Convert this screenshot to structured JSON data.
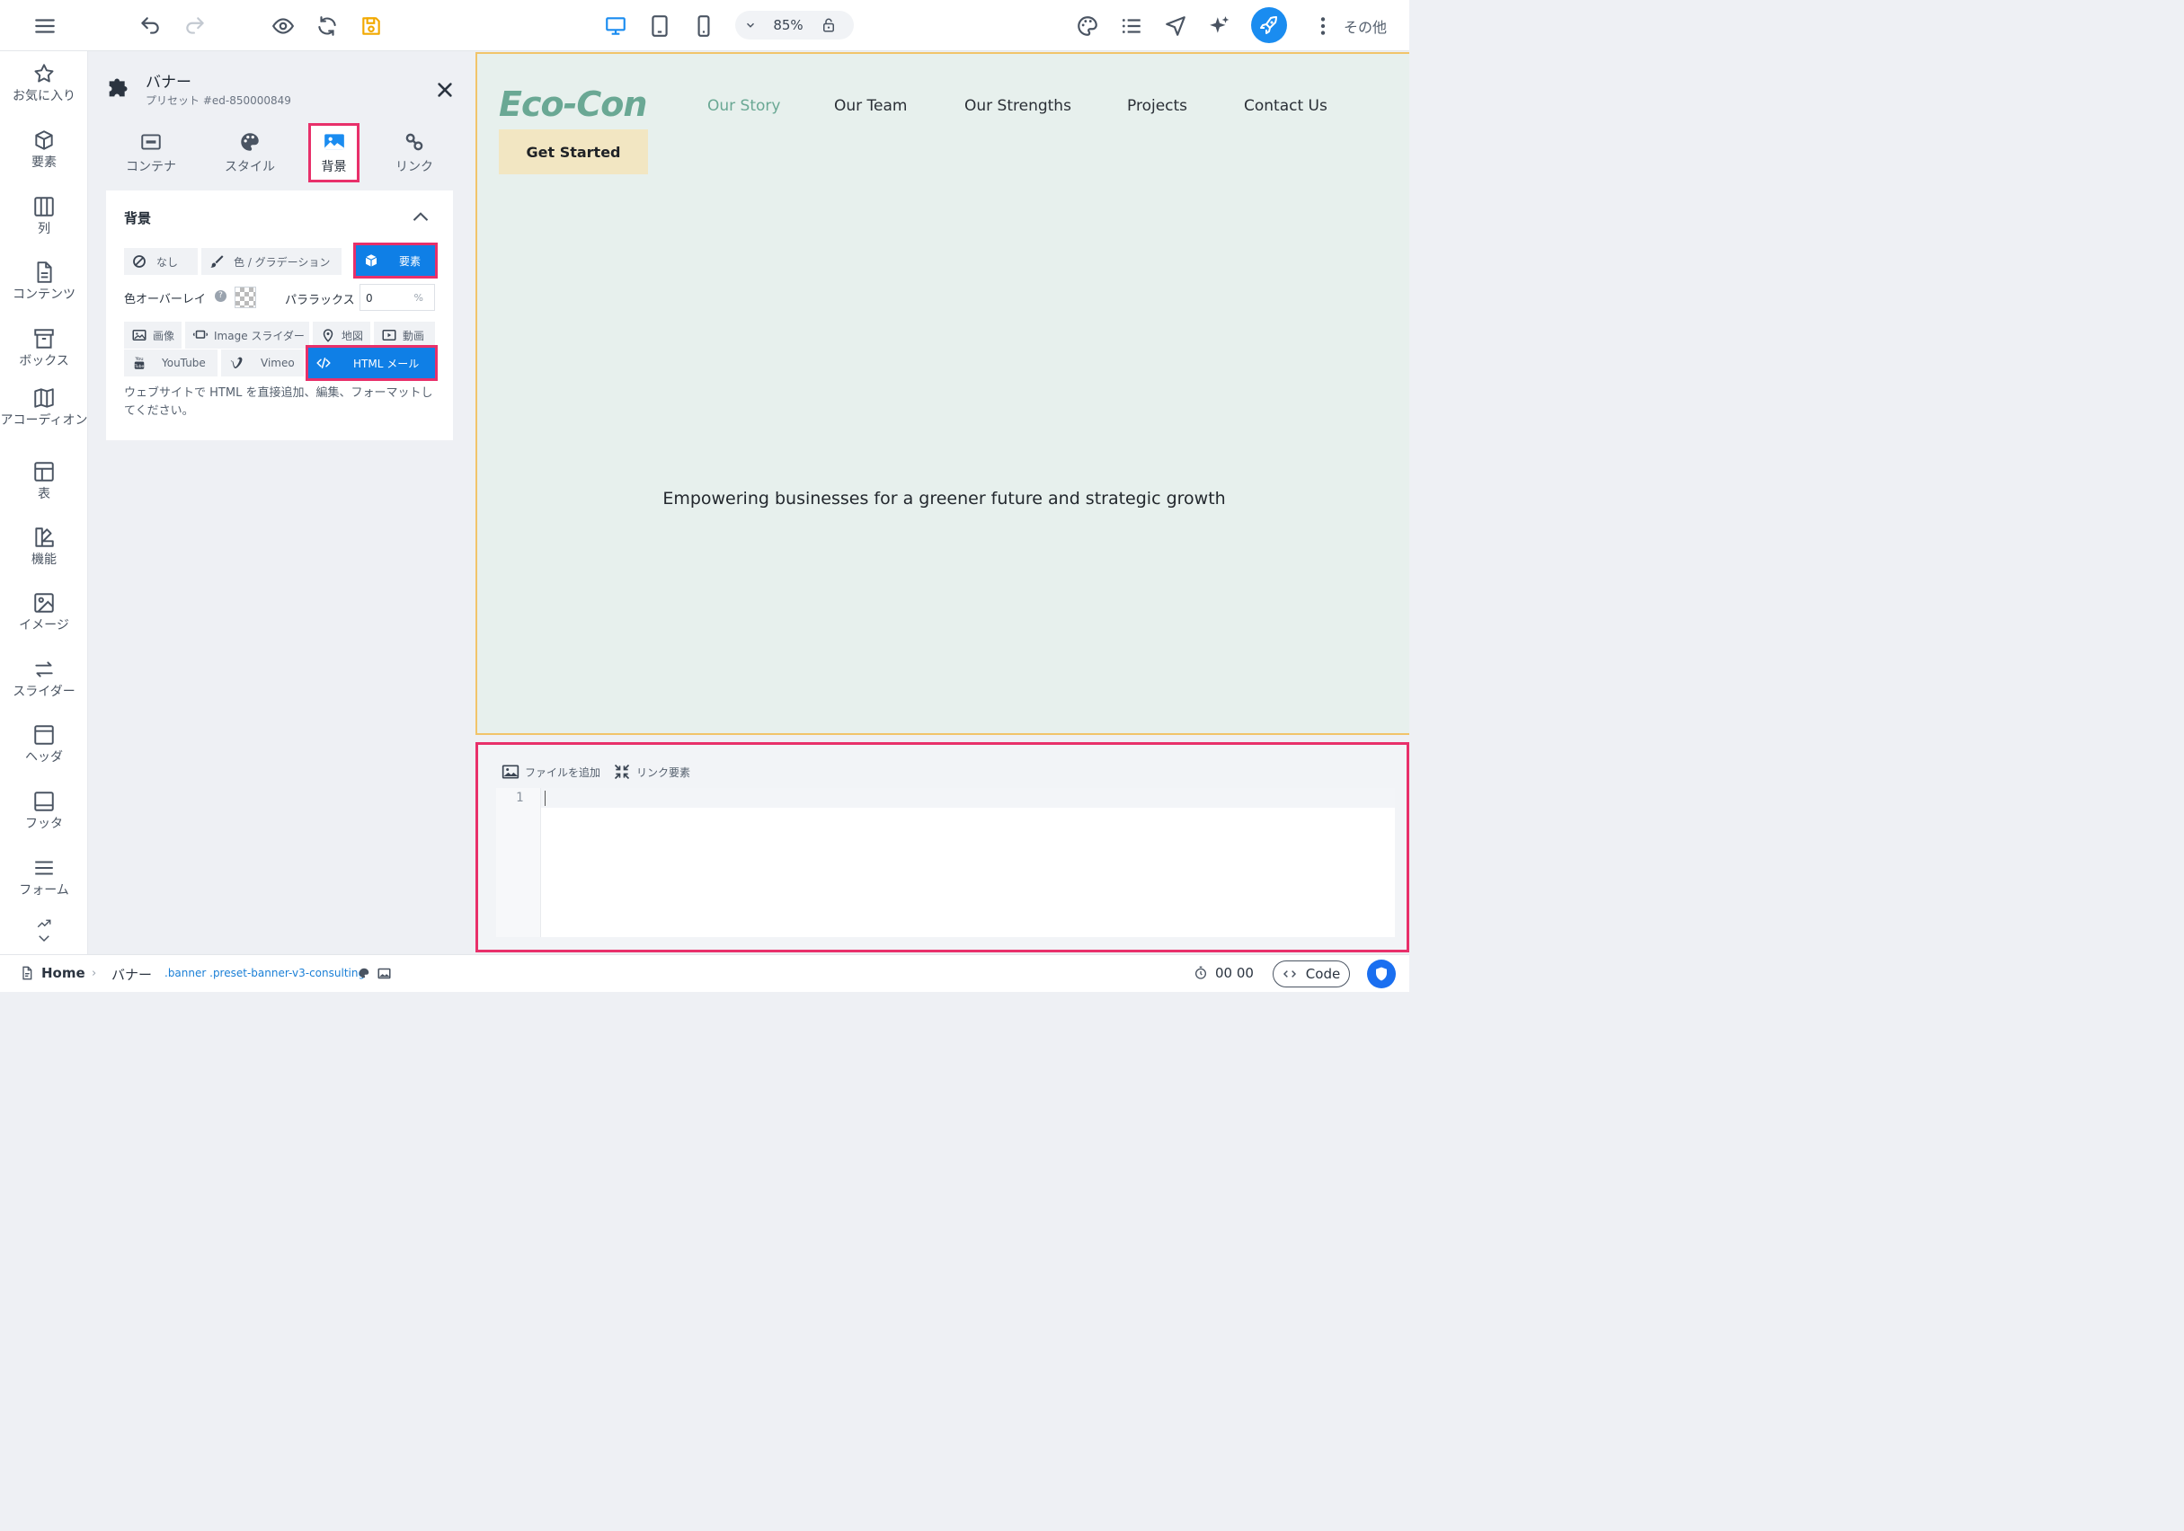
{
  "toolbar": {
    "zoom": "85%",
    "more_label": "その他",
    "colors": {
      "accent": "#1a8cf0",
      "save": "#f2a900",
      "device_active": "#1a8cf0"
    }
  },
  "rail": {
    "items": [
      {
        "label": "お気に入り",
        "icon": "star-icon"
      },
      {
        "label": "要素",
        "icon": "cube-icon"
      },
      {
        "label": "列",
        "icon": "columns-icon"
      },
      {
        "label": "コンテンツ",
        "icon": "document-icon"
      },
      {
        "label": "ボックス",
        "icon": "archive-icon"
      },
      {
        "label": "アコーディオン",
        "icon": "accordion-icon"
      },
      {
        "label": "表",
        "icon": "table-icon"
      },
      {
        "label": "機能",
        "icon": "features-icon"
      },
      {
        "label": "イメージ",
        "icon": "image-icon"
      },
      {
        "label": "スライダー",
        "icon": "arrows-icon"
      },
      {
        "label": "ヘッダ",
        "icon": "header-icon"
      },
      {
        "label": "フッタ",
        "icon": "footer-icon"
      },
      {
        "label": "フォーム",
        "icon": "form-icon"
      }
    ]
  },
  "panel": {
    "title": "バナー",
    "subtitle": "プリセット #ed-850000849",
    "tabs": [
      {
        "label": "コンテナ",
        "icon": "container-icon"
      },
      {
        "label": "スタイル",
        "icon": "palette-icon"
      },
      {
        "label": "背景",
        "icon": "image-icon"
      },
      {
        "label": "リンク",
        "icon": "link-icon"
      }
    ],
    "active_tab": "背景",
    "section_title": "背景",
    "bg_types": [
      "なし",
      "色 / グラデーション",
      "要素"
    ],
    "overlay_label": "色オーバーレイ",
    "parallax_label": "パララックス",
    "parallax_value": "0",
    "parallax_unit": "%",
    "elements": [
      "画像",
      "Image スライダー",
      "地図",
      "動画",
      "YouTube",
      "Vimeo",
      "HTML メール"
    ],
    "help_text": "ウェブサイトで HTML を直接追加、編集、フォーマットしてください。"
  },
  "site": {
    "logo": "Eco-Con",
    "nav": [
      "Our Story",
      "Our Team",
      "Our Strengths",
      "Projects",
      "Contact Us"
    ],
    "cta": "Get Started",
    "tagline": "Empowering businesses for a greener future and strategic growth",
    "colors": {
      "bg": "#e7f0ed",
      "brand": "#6aa894",
      "cta_bg": "#f2e6c2"
    }
  },
  "editor": {
    "add_file": "ファイルを追加",
    "link_elements": "リンク要素",
    "line_number": "1"
  },
  "status": {
    "home": "Home",
    "crumb": "バナー",
    "crumb_classes": ".banner .preset-banner-v3-consulting",
    "timer": "00 00",
    "code": "Code"
  }
}
